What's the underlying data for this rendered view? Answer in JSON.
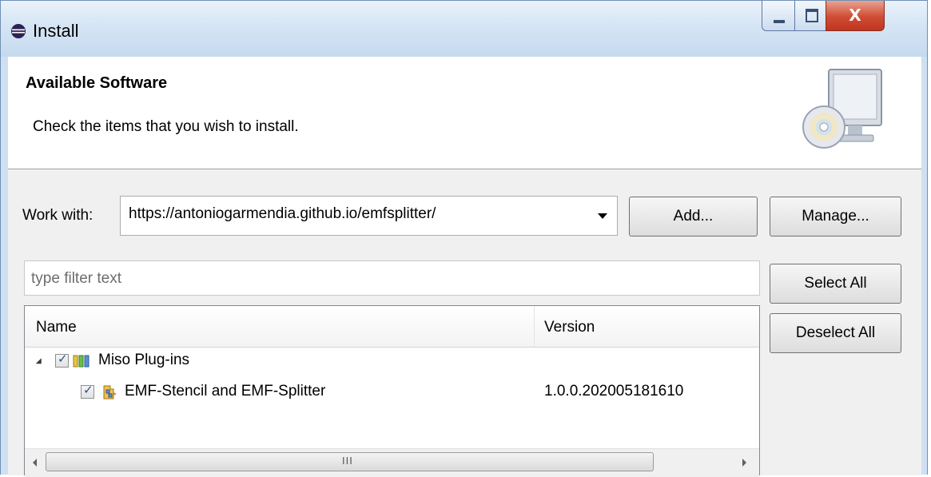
{
  "window": {
    "title": "Install",
    "icon": "eclipse-icon",
    "controls": {
      "minimize": "minimize-icon",
      "maximize": "maximize-icon",
      "close_glyph": "X"
    }
  },
  "banner": {
    "title": "Available Software",
    "description": "Check the items that you wish to install.",
    "icon": "install-graphic-icon"
  },
  "work_with": {
    "label": "Work with:",
    "value": "https://antoniogarmendia.github.io/emfsplitter/"
  },
  "buttons": {
    "add": "Add...",
    "manage": "Manage...",
    "select_all": "Select All",
    "deselect_all": "Deselect All"
  },
  "filter": {
    "placeholder": "type filter text"
  },
  "tree": {
    "columns": {
      "name": "Name",
      "version": "Version"
    },
    "rows": [
      {
        "label": "Miso Plug-ins",
        "checked": true,
        "expanded": true,
        "version": ""
      },
      {
        "label": "EMF-Stencil and EMF-Splitter",
        "checked": true,
        "version": "1.0.0.202005181610"
      }
    ]
  },
  "scrollbar": {
    "grip": "III"
  },
  "colors": {
    "title_bar": "#d7e6f5",
    "close_button": "#cf4c33",
    "dialog_body": "#f0f0f0"
  }
}
